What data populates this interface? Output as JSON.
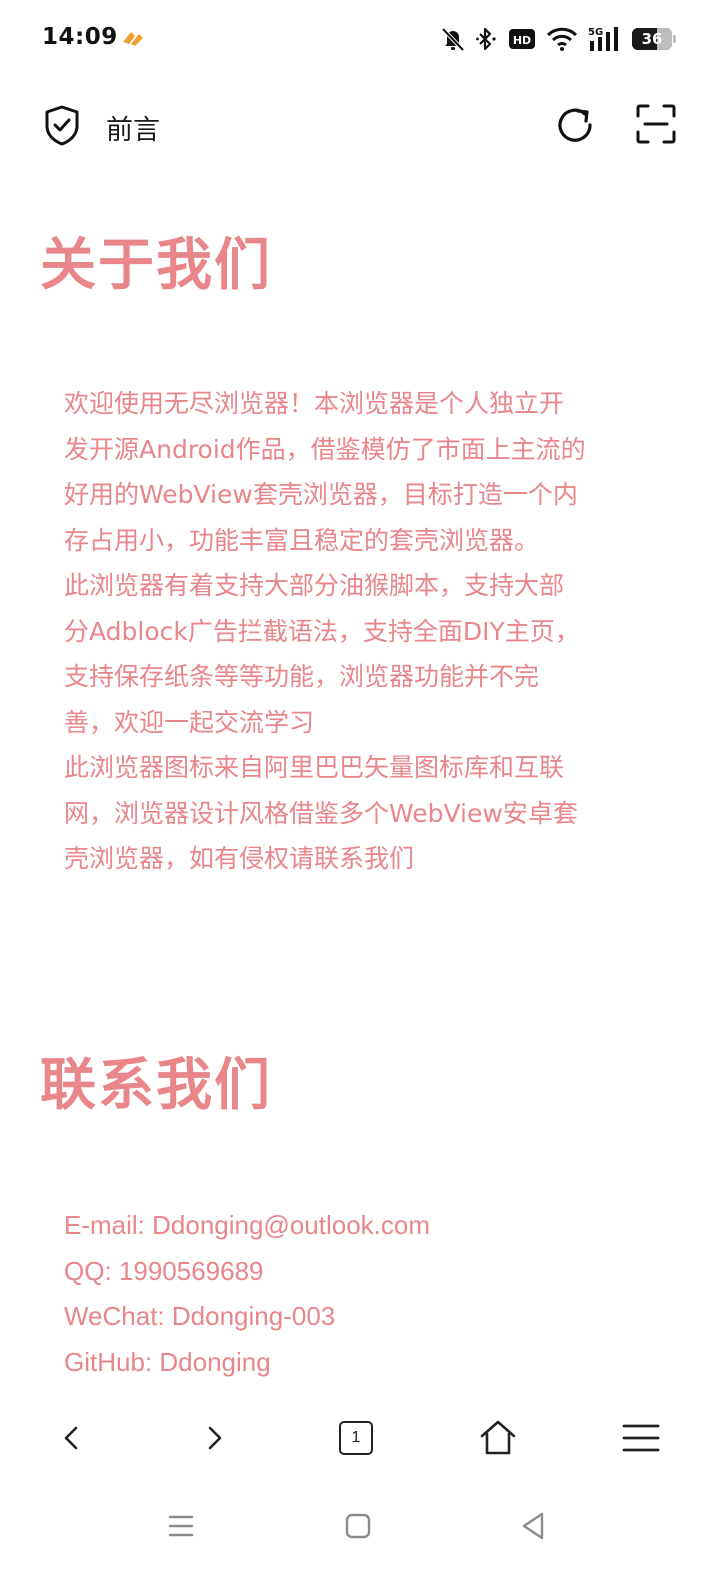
{
  "status_bar": {
    "time": "14:09",
    "battery_level": "36",
    "icons": [
      "app-notification-icon",
      "mute-bell-icon",
      "bluetooth-icon",
      "hd-icon",
      "wifi-icon",
      "signal-5g-icon",
      "battery-icon"
    ]
  },
  "toolbar": {
    "title": "前言",
    "icons": [
      "shield-icon",
      "reload-icon",
      "scan-icon"
    ]
  },
  "about": {
    "heading": "关于我们",
    "lines": [
      "欢迎使用无尽浏览器！本浏览器是个人独立开",
      "发开源Android作品，借鉴模仿了市面上主流的",
      "好用的WebView套壳浏览器，目标打造一个内",
      "存占用小，功能丰富且稳定的套壳浏览器。",
      "此浏览器有着支持大部分油猴脚本，支持大部",
      "分Adblock广告拦截语法，支持全面DIY主页，",
      "支持保存纸条等等功能，浏览器功能并不完",
      "善，欢迎一起交流学习",
      "此浏览器图标来自阿里巴巴矢量图标库和互联",
      "网，浏览器设计风格借鉴多个WebView安卓套",
      "壳浏览器，如有侵权请联系我们"
    ]
  },
  "contact": {
    "heading": "联系我们",
    "email": "E-mail: Ddonging@outlook.com",
    "qq": "QQ: 1990569689",
    "wechat": "WeChat: Ddonging-003",
    "github": "GitHub: Ddonging"
  },
  "bottom_nav": {
    "tab_count": "1",
    "icons": [
      "back-icon",
      "forward-icon",
      "tabs-icon",
      "home-icon",
      "menu-icon"
    ]
  },
  "system_nav": {
    "icons": [
      "recents-icon",
      "home-square-icon",
      "back-triangle-icon"
    ]
  },
  "colors": {
    "accent": "#e8868a",
    "text": "#1a1a1a",
    "background": "#ffffff"
  }
}
